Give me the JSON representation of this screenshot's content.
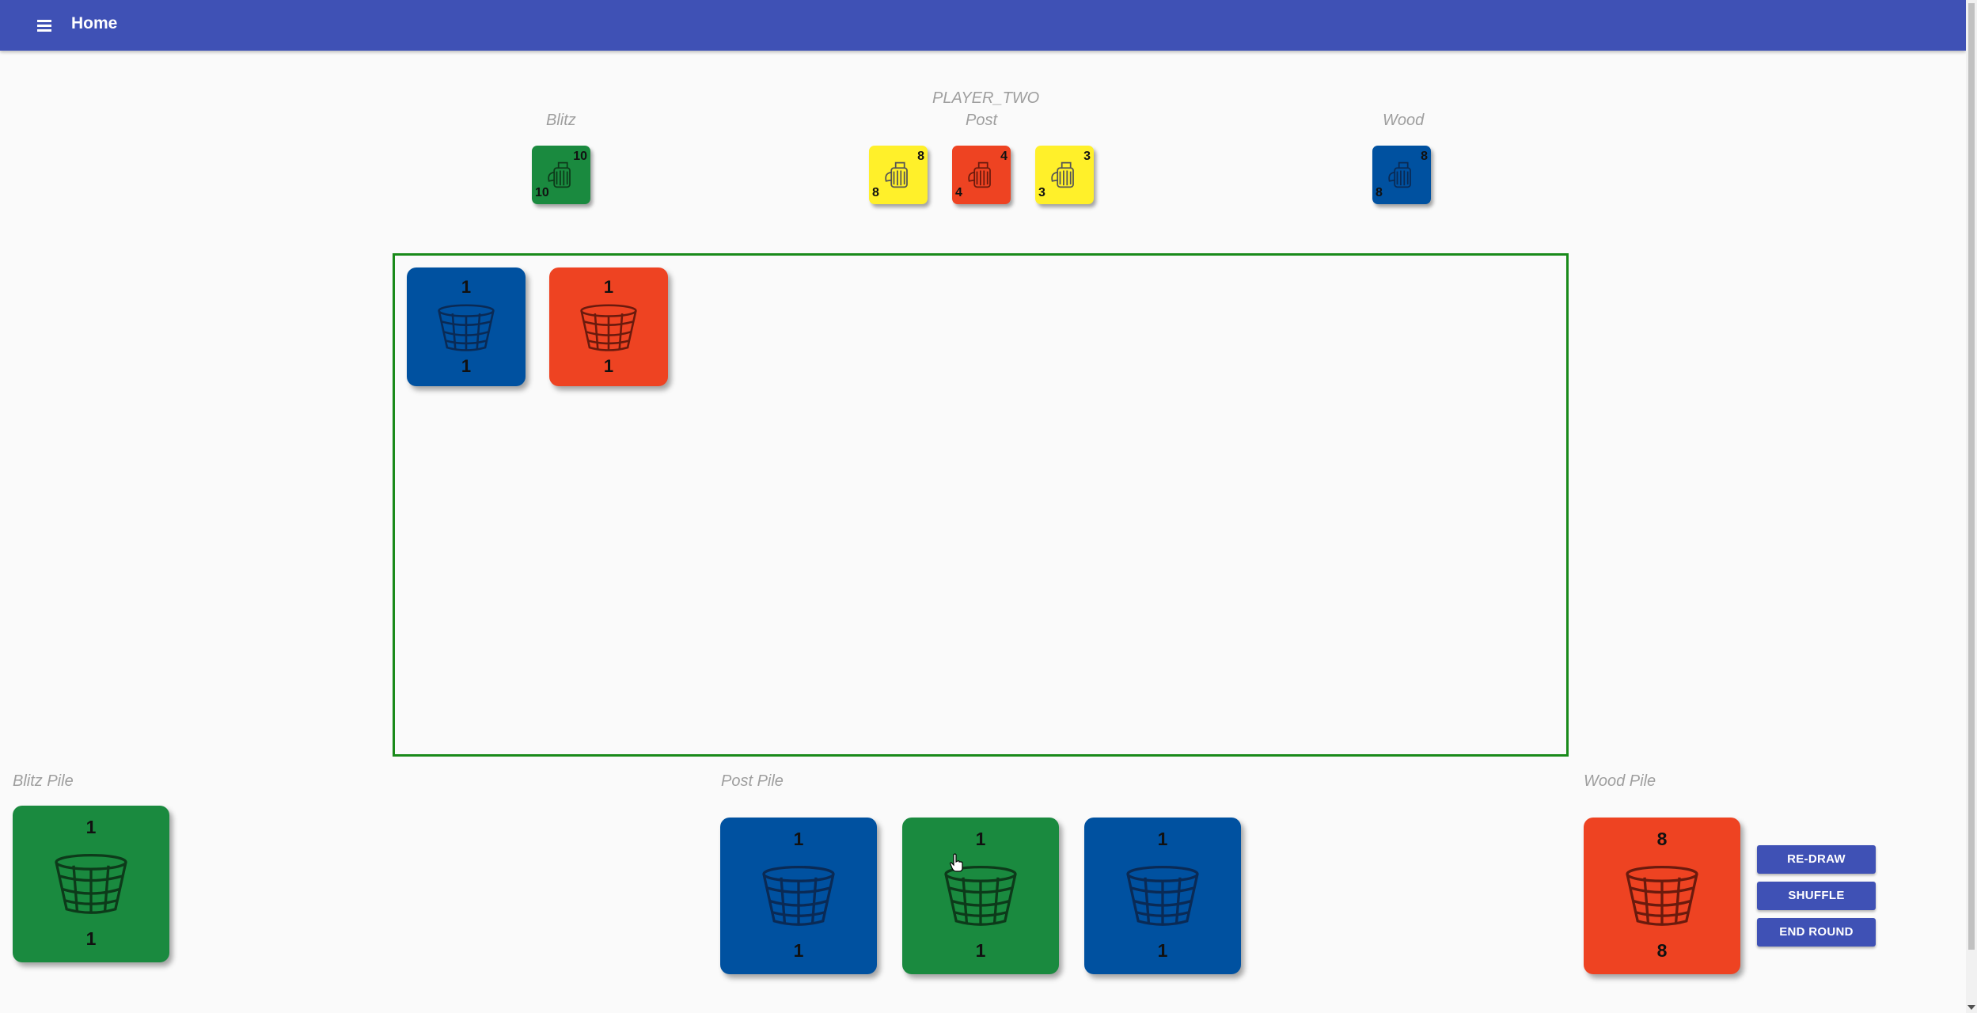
{
  "app": {
    "title": "Home"
  },
  "opponent": {
    "name": "PLAYER_TWO",
    "blitz_label": "Blitz",
    "post_label": "Post",
    "wood_label": "Wood",
    "blitz_card": {
      "value": "10",
      "color": "green"
    },
    "post_cards": [
      {
        "value": "8",
        "color": "yellow"
      },
      {
        "value": "4",
        "color": "red"
      },
      {
        "value": "3",
        "color": "yellow"
      }
    ],
    "wood_card": {
      "value": "8",
      "color": "blue"
    }
  },
  "center": {
    "cards": [
      {
        "value": "1",
        "color": "blue"
      },
      {
        "value": "1",
        "color": "red"
      }
    ]
  },
  "player": {
    "blitz_label": "Blitz Pile",
    "post_label": "Post Pile",
    "wood_label": "Wood Pile",
    "blitz_card": {
      "value": "1",
      "color": "green"
    },
    "post_cards": [
      {
        "value": "1",
        "color": "blue"
      },
      {
        "value": "1",
        "color": "green"
      },
      {
        "value": "1",
        "color": "blue"
      }
    ],
    "wood_card": {
      "value": "8",
      "color": "red"
    }
  },
  "buttons": {
    "redraw": "RE-DRAW",
    "shuffle": "SHUFFLE",
    "end_round": "END ROUND"
  },
  "colors": {
    "appbar": "#3f51b5",
    "green": "#1a8a3f",
    "blue": "#0051a0",
    "red": "#ee4322",
    "yellow": "#fff02a",
    "board_border": "#198a1a"
  },
  "icons": {
    "opponent_card_art": "water-pump-icon",
    "player_card_art": "basket-icon"
  }
}
